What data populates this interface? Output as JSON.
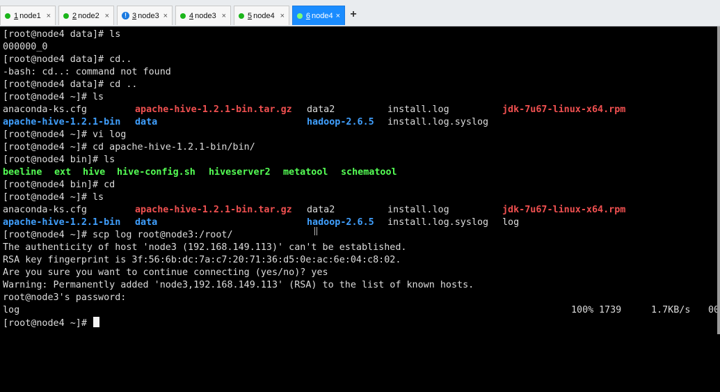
{
  "tabs": [
    {
      "num": "1",
      "name": "node1",
      "status": "green",
      "active": false
    },
    {
      "num": "2",
      "name": "node2",
      "status": "green",
      "active": false
    },
    {
      "num": "3",
      "name": "node3",
      "status": "info",
      "active": false
    },
    {
      "num": "4",
      "name": "node3",
      "status": "green",
      "active": false
    },
    {
      "num": "5",
      "name": "node4",
      "status": "green",
      "active": false
    },
    {
      "num": "6",
      "name": "node4",
      "status": "green",
      "active": true
    }
  ],
  "new_tab_label": "+",
  "close_glyph": "×",
  "terminal": {
    "lines": [
      "[root@node4 data]# ls",
      "000000_0",
      "[root@node4 data]# cd..",
      "-bash: cd..: command not found",
      "[root@node4 data]# cd ..",
      "[root@node4 ~]# ls",
      "",
      "",
      "[root@node4 ~]# vi log",
      "[root@node4 ~]# cd apache-hive-1.2.1-bin/bin/",
      "[root@node4 bin]# ls",
      "",
      "[root@node4 bin]# cd",
      "[root@node4 ~]# ls",
      "",
      "",
      "[root@node4 ~]# scp log root@node3:/root/",
      "The authenticity of host 'node3 (192.168.149.113)' can't be established.",
      "RSA key fingerprint is 3f:56:6b:dc:7a:c7:20:71:36:d5:0e:ac:6e:04:c8:02.",
      "Are you sure you want to continue connecting (yes/no)? yes",
      "Warning: Permanently added 'node3,192.168.149.113' (RSA) to the list of known hosts.",
      "root@node3's password:",
      "log",
      "[root@node4 ~]# "
    ],
    "ls1": {
      "row1": [
        "anaconda-ks.cfg",
        "apache-hive-1.2.1-bin.tar.gz",
        "data2",
        "install.log",
        "jdk-7u67-linux-x64.rpm"
      ],
      "row2": [
        "apache-hive-1.2.1-bin",
        "data",
        "hadoop-2.6.5",
        "install.log.syslog"
      ]
    },
    "bin_ls": [
      "beeline",
      "ext",
      "hive",
      "hive-config.sh",
      "hiveserver2",
      "metatool",
      "schematool"
    ],
    "ls2": {
      "row1": [
        "anaconda-ks.cfg",
        "apache-hive-1.2.1-bin.tar.gz",
        "data2",
        "install.log",
        "jdk-7u67-linux-x64.rpm"
      ],
      "row2": [
        "apache-hive-1.2.1-bin",
        "data",
        "hadoop-2.6.5",
        "install.log.syslog",
        "log"
      ]
    },
    "transfer": {
      "percent": "100%",
      "bytes": "1739",
      "rate": "1.7KB/s",
      "eta": "00"
    }
  },
  "colors": {
    "background": "#000000",
    "text": "#dcdcdc",
    "archive": "#f05050",
    "directory": "#40a0ff",
    "executable": "#55ff55",
    "active_tab": "#1a8cff"
  }
}
